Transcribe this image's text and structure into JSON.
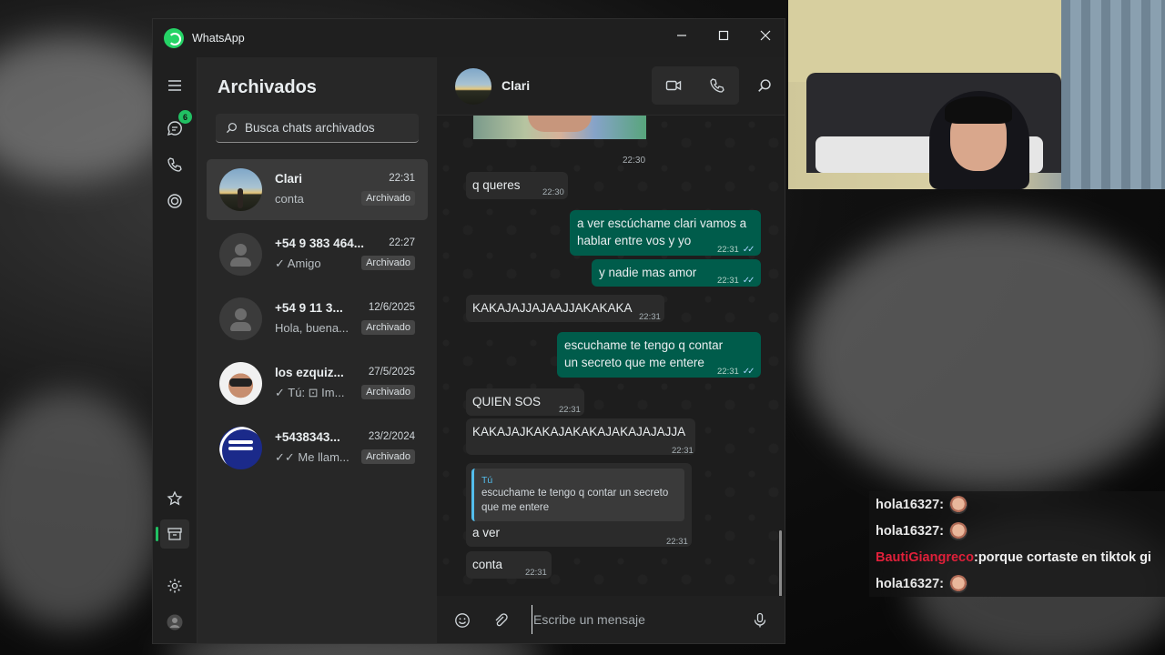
{
  "window": {
    "app_title": "WhatsApp",
    "controls": {
      "minimize": "—",
      "maximize": "☐",
      "close": "✕"
    }
  },
  "rail": {
    "chats_badge": "6",
    "icons": [
      "menu-icon",
      "chats-icon",
      "calls-icon",
      "status-icon",
      "starred-icon",
      "archive-icon",
      "settings-icon",
      "profile-avatar"
    ]
  },
  "list": {
    "title": "Archivados",
    "search_placeholder": "Busca chats archivados",
    "chats": [
      {
        "name": "Clari",
        "time": "22:31",
        "preview": "conta",
        "tag": "Archivado",
        "avatar": "sunset"
      },
      {
        "name": "+54 9 383 464...",
        "time": "22:27",
        "preview": "✓ Amigo",
        "tag": "Archivado",
        "avatar": "generic"
      },
      {
        "name": "+54 9 11 3...",
        "time": "12/6/2025",
        "preview": "Hola, buena...",
        "tag": "Archivado",
        "avatar": "generic"
      },
      {
        "name": "los ezquiz...",
        "time": "27/5/2025",
        "preview": "✓ Tú: ⊡ Im...",
        "tag": "Archivado",
        "avatar": "face"
      },
      {
        "name": "+5438343...",
        "time": "23/2/2024",
        "preview": "✓✓ Me llam...",
        "tag": "Archivado",
        "avatar": "logo"
      }
    ]
  },
  "conversation": {
    "contact_name": "Clari",
    "date_label": "22:30",
    "messages": [
      {
        "dir": "in",
        "text": "q queres",
        "time": "22:30"
      },
      {
        "dir": "out",
        "text": "a ver escúchame clari vamos a hablar entre vos y yo",
        "time": "22:31"
      },
      {
        "dir": "out",
        "text": "y nadie mas amor",
        "time": "22:31"
      },
      {
        "dir": "in",
        "text": "KAKAJAJJAJAAJJAKAKAKA",
        "time": "22:31"
      },
      {
        "dir": "out",
        "text": "escuchame te tengo q contar un secreto que me entere",
        "time": "22:31"
      },
      {
        "dir": "in",
        "text": "QUIEN SOS",
        "time": "22:31"
      },
      {
        "dir": "in",
        "text": "KAKAJAJKAKAJAKAKAJAKAJAJAJJA",
        "time": "22:31"
      },
      {
        "dir": "in",
        "quote_author": "Tú",
        "quote_text": "escuchame te tengo q contar un secreto que me entere",
        "text": "a ver",
        "time": "22:31"
      },
      {
        "dir": "in",
        "text": "conta",
        "time": "22:31"
      }
    ],
    "compose_placeholder": "Escribe un mensaje"
  },
  "stream_chat": [
    {
      "user": "hola16327",
      "sep": " :",
      "message": "",
      "user_color": "#e8e8e8"
    },
    {
      "user": "hola16327",
      "sep": " :",
      "message": "",
      "user_color": "#e8e8e8"
    },
    {
      "user": "BautiGiangreco",
      "sep": ":",
      "message": " porque cortaste en tiktok gi",
      "user_color": "#e0203a"
    },
    {
      "user": "hola16327",
      "sep": " :",
      "message": "",
      "user_color": "#e8e8e8"
    }
  ],
  "colors": {
    "accent": "#21c063",
    "outgoing_bubble": "#005c4b",
    "incoming_bubble": "#2b2b2b",
    "panel": "#272727"
  }
}
